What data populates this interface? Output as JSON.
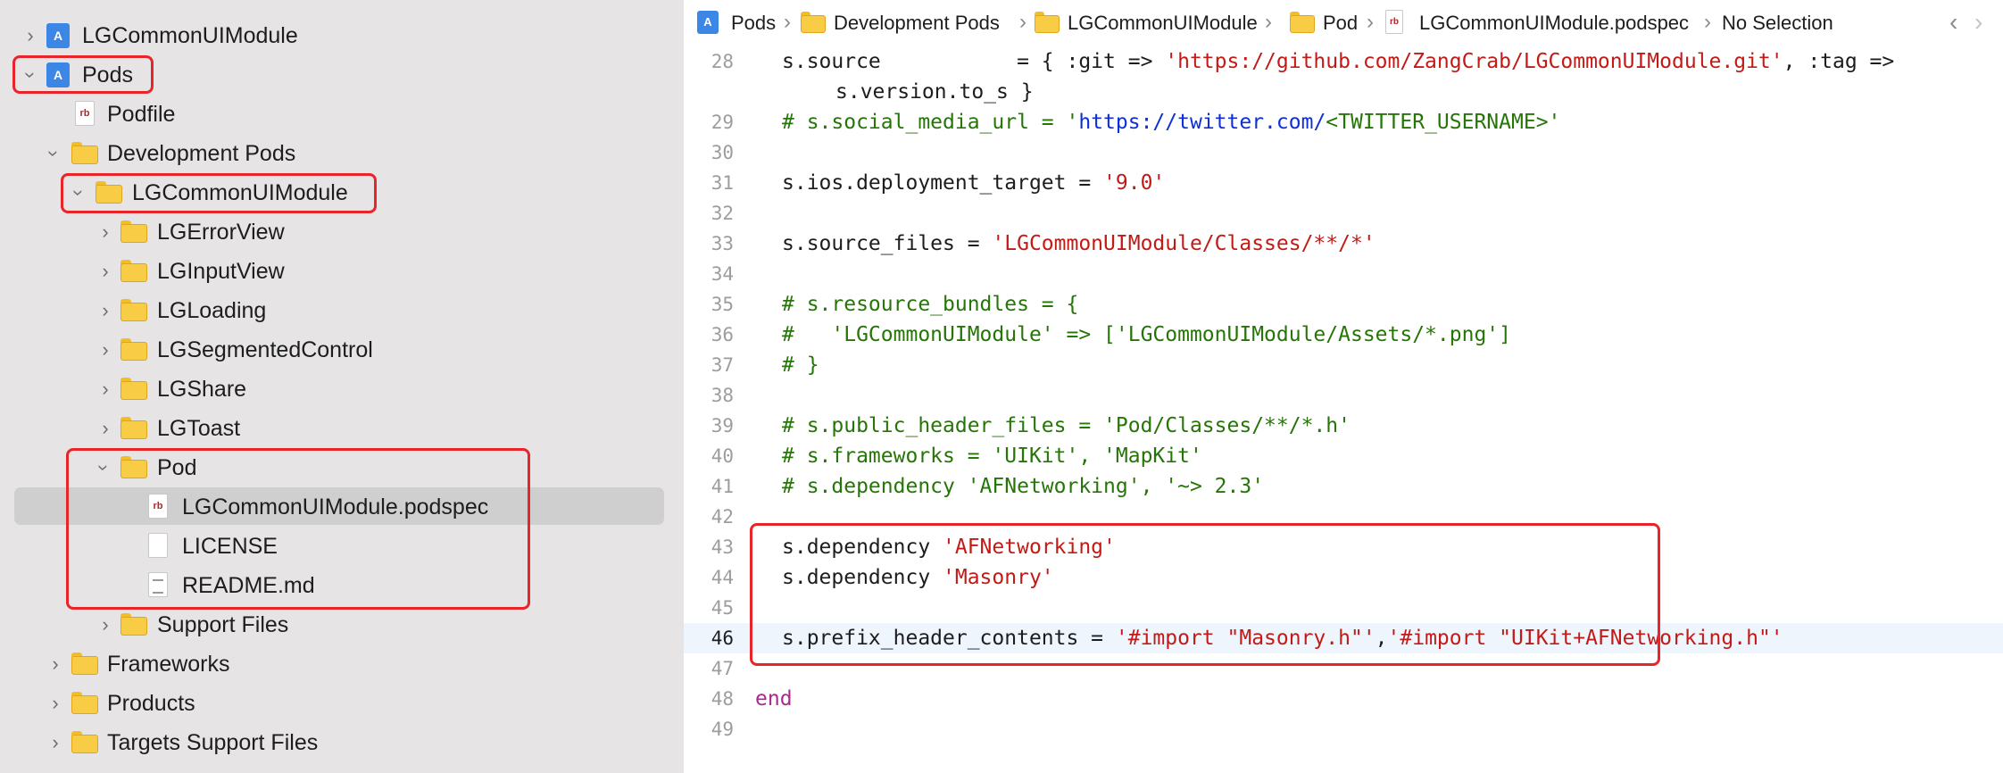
{
  "sidebar": {
    "items": [
      {
        "label": "LGCommonUIModule",
        "icon": "xcode-project-icon",
        "chevron": "right"
      },
      {
        "label": "Pods",
        "icon": "xcode-project-icon",
        "chevron": "down"
      },
      {
        "label": "Podfile",
        "icon": "ruby-file-icon",
        "icon_text": "rb"
      },
      {
        "label": "Development Pods",
        "icon": "folder-icon",
        "chevron": "down"
      },
      {
        "label": "LGCommonUIModule",
        "icon": "folder-icon",
        "chevron": "down"
      },
      {
        "label": "LGErrorView",
        "icon": "folder-icon",
        "chevron": "right"
      },
      {
        "label": "LGInputView",
        "icon": "folder-icon",
        "chevron": "right"
      },
      {
        "label": "LGLoading",
        "icon": "folder-icon",
        "chevron": "right"
      },
      {
        "label": "LGSegmentedControl",
        "icon": "folder-icon",
        "chevron": "right"
      },
      {
        "label": "LGShare",
        "icon": "folder-icon",
        "chevron": "right"
      },
      {
        "label": "LGToast",
        "icon": "folder-icon",
        "chevron": "right"
      },
      {
        "label": "Pod",
        "icon": "folder-icon",
        "chevron": "down"
      },
      {
        "label": "LGCommonUIModule.podspec",
        "icon": "ruby-file-icon",
        "icon_text": "rb",
        "selected": true
      },
      {
        "label": "LICENSE",
        "icon": "document-icon"
      },
      {
        "label": "README.md",
        "icon": "document-icon"
      },
      {
        "label": "Support Files",
        "icon": "folder-icon",
        "chevron": "right"
      },
      {
        "label": "Frameworks",
        "icon": "folder-icon",
        "chevron": "right"
      },
      {
        "label": "Products",
        "icon": "folder-icon",
        "chevron": "right"
      },
      {
        "label": "Targets Support Files",
        "icon": "folder-icon",
        "chevron": "right"
      }
    ]
  },
  "jumpbar": {
    "crumbs": [
      "Pods",
      "Development Pods",
      "LGCommonUIModule",
      "Pod",
      "LGCommonUIModule.podspec",
      "No Selection"
    ],
    "rb_icon_text": "rb",
    "back_glyph": "‹",
    "forward_glyph": "›",
    "separator": "›"
  },
  "editor": {
    "current_line": "46",
    "lines": [
      {
        "n": "28",
        "p1": "s.source           = { :git => ",
        "s1": "'https://github.com/ZangCrab/LGCommonUIModule.git'",
        "p2": ", :tag =>"
      },
      {
        "n": "",
        "cont": "s.version.to_s }"
      },
      {
        "n": "29",
        "c1": "# s.social_media_url = '",
        "u1": "https://twitter.com/",
        "c2": "<TWITTER_USERNAME>'"
      },
      {
        "n": "30"
      },
      {
        "n": "31",
        "p1": "s.ios.deployment_target = ",
        "s1": "'9.0'"
      },
      {
        "n": "32"
      },
      {
        "n": "33",
        "p1": "s.source_files = ",
        "s1": "'LGCommonUIModule/Classes/**/*'"
      },
      {
        "n": "34"
      },
      {
        "n": "35",
        "c1": "# s.resource_bundles = {"
      },
      {
        "n": "36",
        "c1": "#   'LGCommonUIModule' => ['LGCommonUIModule/Assets/*.png']"
      },
      {
        "n": "37",
        "c1": "# }"
      },
      {
        "n": "38"
      },
      {
        "n": "39",
        "c1": "# s.public_header_files = 'Pod/Classes/**/*.h'"
      },
      {
        "n": "40",
        "c1": "# s.frameworks = 'UIKit', 'MapKit'"
      },
      {
        "n": "41",
        "c1": "# s.dependency 'AFNetworking', '~> 2.3'"
      },
      {
        "n": "42"
      },
      {
        "n": "43",
        "p1": "s.dependency ",
        "s1": "'AFNetworking'"
      },
      {
        "n": "44",
        "p1": "s.dependency ",
        "s1": "'Masonry'"
      },
      {
        "n": "45"
      },
      {
        "n": "46",
        "p1": "s.prefix_header_contents = ",
        "s1": "'#import \"Masonry.h\"'",
        "p2": ",",
        "s2": "'#import \"UIKit+AFNetworking.h\"'"
      },
      {
        "n": "47"
      },
      {
        "n": "48",
        "k1": "end"
      },
      {
        "n": "49"
      }
    ]
  },
  "colors": {
    "sidebar_bg": "#e6e4e4",
    "selection_bg": "#d0cfcf",
    "callout": "#e8252a",
    "string": "#c41a16",
    "comment": "#267507",
    "url": "#0e2fd6",
    "keyword": "#a72991",
    "folder": "#f8cc45",
    "project": "#3c86e6"
  }
}
